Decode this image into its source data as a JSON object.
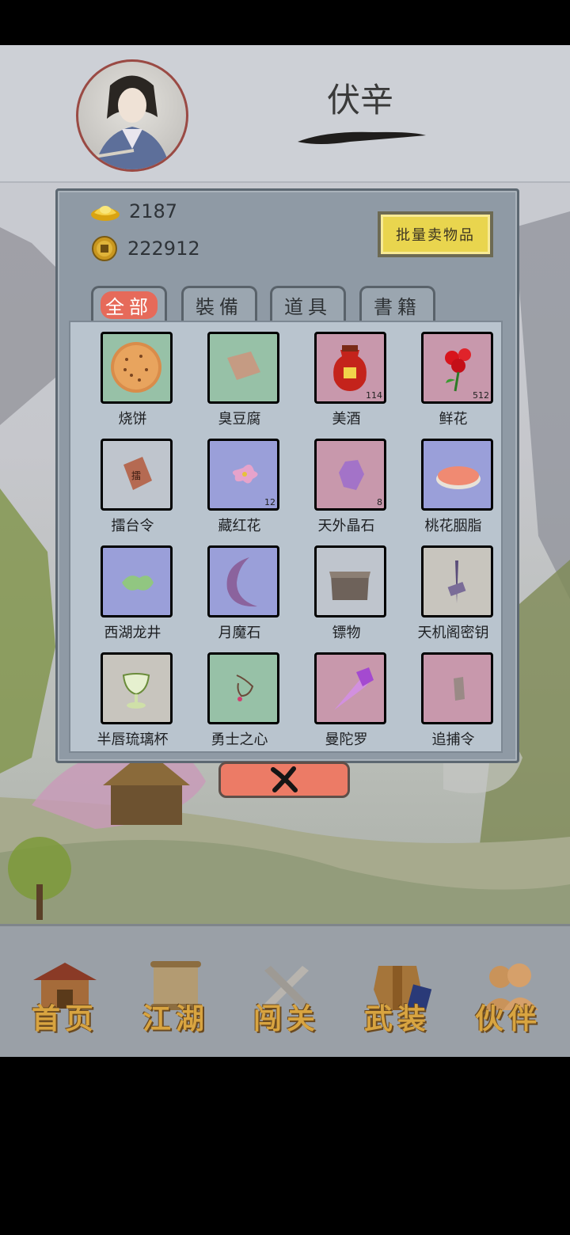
{
  "player": {
    "name": "伏辛"
  },
  "currencies": {
    "gold_ingot": "2187",
    "coins": "222912"
  },
  "sell_button": "批量卖物品",
  "tabs": [
    "全部",
    "裝備",
    "道具",
    "書籍"
  ],
  "active_tab": 0,
  "items": [
    {
      "name": "烧饼",
      "quality": "green",
      "icon": "flatbread-icon",
      "count": ""
    },
    {
      "name": "臭豆腐",
      "quality": "green",
      "icon": "tofu-icon",
      "count": ""
    },
    {
      "name": "美酒",
      "quality": "red",
      "icon": "wine-jar-icon",
      "count": "114"
    },
    {
      "name": "鲜花",
      "quality": "red",
      "icon": "rose-icon",
      "count": "512"
    },
    {
      "name": "擂台令",
      "quality": "white",
      "icon": "token-icon",
      "count": ""
    },
    {
      "name": "藏红花",
      "quality": "blue",
      "icon": "saffron-icon",
      "count": "12"
    },
    {
      "name": "天外晶石",
      "quality": "red",
      "icon": "crystal-icon",
      "count": "8"
    },
    {
      "name": "桃花胭脂",
      "quality": "blue",
      "icon": "rouge-icon",
      "count": ""
    },
    {
      "name": "西湖龙井",
      "quality": "blue",
      "icon": "tea-icon",
      "count": ""
    },
    {
      "name": "月魔石",
      "quality": "blue",
      "icon": "moon-stone-icon",
      "count": ""
    },
    {
      "name": "镖物",
      "quality": "white",
      "icon": "chest-icon",
      "count": ""
    },
    {
      "name": "天机阁密钥",
      "quality": "orange",
      "icon": "key-icon",
      "count": ""
    },
    {
      "name": "半唇琉璃杯",
      "quality": "orange",
      "icon": "cup-icon",
      "count": ""
    },
    {
      "name": "勇士之心",
      "quality": "green",
      "icon": "pendant-icon",
      "count": ""
    },
    {
      "name": "曼陀罗",
      "quality": "red",
      "icon": "mandala-crystal-icon",
      "count": ""
    },
    {
      "name": "追捕令",
      "quality": "red",
      "icon": "warrant-icon",
      "count": ""
    }
  ],
  "close_icon": "close-icon",
  "nav": [
    {
      "label": "首页",
      "icon": "house-icon"
    },
    {
      "label": "江湖",
      "icon": "scroll-icon"
    },
    {
      "label": "闯关",
      "icon": "swords-icon"
    },
    {
      "label": "武装",
      "icon": "armor-icon"
    },
    {
      "label": "伙伴",
      "icon": "partners-icon"
    }
  ]
}
